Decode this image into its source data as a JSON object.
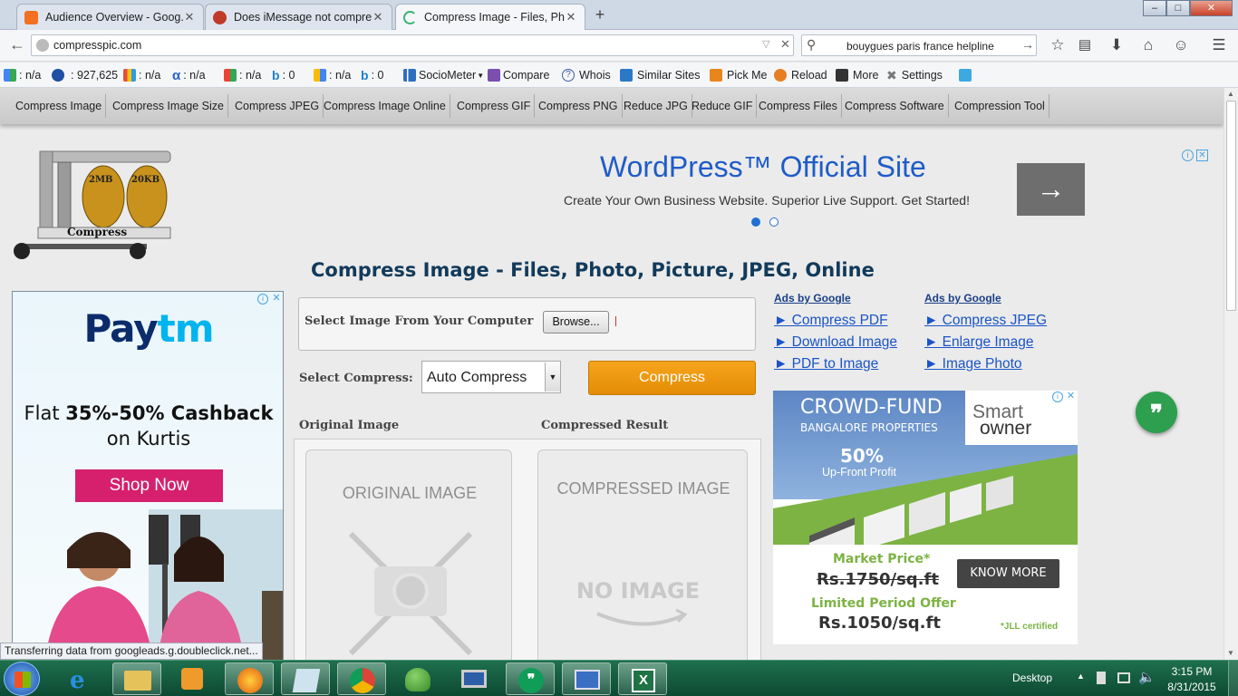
{
  "browser": {
    "tabs": [
      {
        "title": "Audience Overview - Goog...",
        "active": false
      },
      {
        "title": "Does iMessage not compre...",
        "active": false
      },
      {
        "title": "Compress Image - Files, Ph...",
        "active": true
      }
    ],
    "new_tab": "+",
    "window_controls": {
      "minimize": "‒",
      "maximize": "□",
      "close": "✕"
    },
    "url": "compresspic.com",
    "search_value": "bouygues paris france helpline"
  },
  "addon_bar": {
    "items": [
      {
        "label": ": n/a"
      },
      {
        "label": ": 927,625"
      },
      {
        "label": ": n/a"
      },
      {
        "label": ": n/a"
      },
      {
        "label": ": n/a"
      },
      {
        "label": ": 0"
      },
      {
        "label": ": n/a"
      },
      {
        "label": ": 0"
      },
      {
        "label": "SocioMeter"
      },
      {
        "label": "Compare"
      },
      {
        "label": "Whois"
      },
      {
        "label": "Similar Sites"
      },
      {
        "label": "Pick Me"
      },
      {
        "label": "Reload"
      },
      {
        "label": "More"
      },
      {
        "label": "Settings"
      }
    ]
  },
  "site_nav": [
    "Compress Image",
    "Compress Image Size",
    "Compress JPEG",
    "Compress Image Online",
    "Compress GIF",
    "Compress PNG",
    "Reduce JPG",
    "Reduce GIF",
    "Compress Files",
    "Compress Software",
    "Compression Tool"
  ],
  "logo": {
    "weight_left": "2MB",
    "weight_right": "20KB",
    "caption": "Compress"
  },
  "top_ad": {
    "title": "WordPress™ Official Site",
    "text": "Create Your Own Business Website. Superior Live Support. Get Started!",
    "arrow": "→"
  },
  "page_title": "Compress Image - Files, Photo, Picture, JPEG, Online",
  "upload": {
    "select_label": "Select Image From Your Computer",
    "browse_label": "Browse...",
    "compress_label": "Select Compress:",
    "compress_value": "Auto Compress",
    "compress_button": "Compress"
  },
  "result": {
    "original_heading": "Original Image",
    "compressed_heading": "Compressed Result",
    "original_placeholder": "ORIGINAL IMAGE",
    "compressed_placeholder": "COMPRESSED IMAGE",
    "no_image": "NO IMAGE"
  },
  "left_ad": {
    "brand": "Paytm",
    "line1_pre": "Flat ",
    "line1_bold": "35%-50% Cashback",
    "line2": "on Kurtis",
    "button": "Shop Now"
  },
  "ads_by_google": {
    "heading": "Ads by Google",
    "col1": [
      "► Compress PDF",
      "► Download Image",
      "► PDF to Image"
    ],
    "col2": [
      "► Compress JPEG",
      "► Enlarge Image",
      "► Image Photo"
    ]
  },
  "right_ad": {
    "title": "CROWD-FUND",
    "subtitle": "BANGALORE PROPERTIES",
    "logo_line1": "Smart",
    "logo_line2": "owner",
    "percent": "50%",
    "percent_label": "Up-Front Profit",
    "market_label": "Market Price*",
    "old_price": "Rs.1750/sq.ft",
    "offer_label": "Limited Period Offer",
    "new_price": "Rs.1050/sq.ft",
    "cta": "KNOW MORE",
    "footnote": "*JLL certified"
  },
  "status_bar": "Transferring data from googleads.g.doubleclick.net...",
  "taskbar": {
    "desktop_label": "Desktop",
    "time": "3:15 PM",
    "date": "8/31/2015"
  },
  "colors": {
    "accent_orange": "#f29b0c",
    "site_blue": "#123a5a",
    "link_blue": "#1a54c9",
    "paytm_pink": "#d6206d",
    "taskbar_green": "#0c4a33"
  }
}
